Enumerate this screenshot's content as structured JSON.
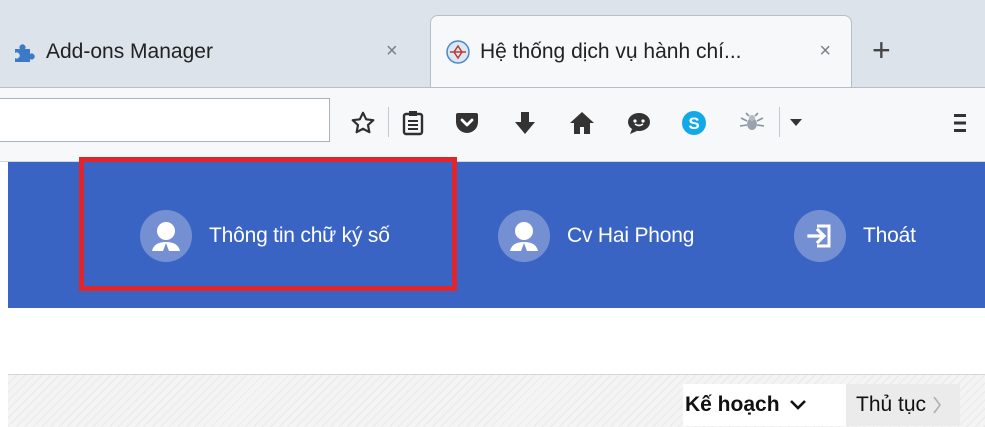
{
  "browser": {
    "tabs": [
      {
        "label": "Add-ons Manager",
        "icon": "puzzle-piece-icon",
        "active": false
      },
      {
        "label": "Hệ thống dịch vụ hành chí...",
        "icon": "site-logo-icon",
        "active": true
      }
    ],
    "close_glyph": "×",
    "new_tab_glyph": "+",
    "toolbar_icons": [
      "star-icon",
      "reading-list-icon",
      "pocket-icon",
      "download-icon",
      "home-icon",
      "chat-icon",
      "skype-icon",
      "bug-icon",
      "dropdown-icon",
      "menu-icon"
    ],
    "accent": "#3a64c3"
  },
  "header": {
    "items": [
      {
        "label": "Thông tin chữ ký số",
        "icon": "user-icon"
      },
      {
        "label": "Cv Hai Phong",
        "icon": "user-icon"
      },
      {
        "label": "Thoát",
        "icon": "logout-icon"
      }
    ],
    "highlight_color": "#e2242b"
  },
  "breadcrumb": {
    "items": [
      {
        "label": "Kế hoạch",
        "icon": "chevron-down-icon"
      },
      {
        "label": "Thủ tục",
        "icon": "chevron-right-icon"
      }
    ]
  }
}
